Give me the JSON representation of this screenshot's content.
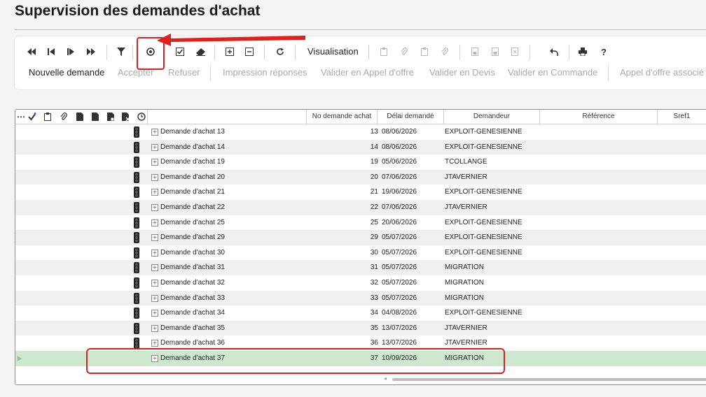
{
  "page": {
    "title": "Supervision des demandes d'achat"
  },
  "toolbar": {
    "visualisation_label": "Visualisation",
    "icons": [
      "first-icon",
      "previous-icon",
      "next-icon",
      "last-icon",
      "filter-icon",
      "target-icon",
      "check-icon",
      "eraser-icon",
      "add-icon",
      "remove-icon",
      "refresh-icon",
      "clipboard-icon",
      "attach-icon",
      "clipboard-icon",
      "attach-icon",
      "doc-icon",
      "doc-icon",
      "doc-icon",
      "undo-icon",
      "print-icon",
      "help-icon"
    ]
  },
  "actions": [
    {
      "label": "Nouvelle demande",
      "enabled": true
    },
    {
      "label": "Accepter",
      "enabled": false
    },
    {
      "label": "Refuser",
      "enabled": false
    },
    {
      "label": "Impression réponses",
      "enabled": false
    },
    {
      "label": "Valider en Appel d'offre",
      "enabled": false
    },
    {
      "label": "Valider en Devis",
      "enabled": false
    },
    {
      "label": "Valider en Commande",
      "enabled": false
    },
    {
      "label": "Appel d'offre associé",
      "enabled": false
    }
  ],
  "grid": {
    "columns": [
      {
        "label": "No demande achat"
      },
      {
        "label": "Délai demandé"
      },
      {
        "label": "Demandeur"
      },
      {
        "label": "Référence"
      },
      {
        "label": "Sref1"
      }
    ],
    "rows": [
      {
        "name": "Demande d'achat 13",
        "no": "13",
        "date": "08/06/2026",
        "demandeur": "EXPLOIT-GENESIENNE"
      },
      {
        "name": "Demande d'achat 14",
        "no": "14",
        "date": "08/06/2026",
        "demandeur": "EXPLOIT-GENESIENNE"
      },
      {
        "name": "Demande d'achat 19",
        "no": "19",
        "date": "05/06/2026",
        "demandeur": "TCOLLANGE"
      },
      {
        "name": "Demande d'achat 20",
        "no": "20",
        "date": "07/06/2026",
        "demandeur": "JTAVERNIER"
      },
      {
        "name": "Demande d'achat 21",
        "no": "21",
        "date": "19/06/2026",
        "demandeur": "EXPLOIT-GENESIENNE"
      },
      {
        "name": "Demande d'achat 22",
        "no": "22",
        "date": "07/06/2026",
        "demandeur": "JTAVERNIER"
      },
      {
        "name": "Demande d'achat 25",
        "no": "25",
        "date": "20/06/2026",
        "demandeur": "EXPLOIT-GENESIENNE"
      },
      {
        "name": "Demande d'achat 29",
        "no": "29",
        "date": "05/07/2026",
        "demandeur": "EXPLOIT-GENESIENNE"
      },
      {
        "name": "Demande d'achat 30",
        "no": "30",
        "date": "05/07/2026",
        "demandeur": "EXPLOIT-GENESIENNE"
      },
      {
        "name": "Demande d'achat 31",
        "no": "31",
        "date": "05/07/2026",
        "demandeur": "MIGRATION"
      },
      {
        "name": "Demande d'achat 32",
        "no": "32",
        "date": "05/07/2026",
        "demandeur": "MIGRATION"
      },
      {
        "name": "Demande d'achat 33",
        "no": "33",
        "date": "05/07/2026",
        "demandeur": "MIGRATION"
      },
      {
        "name": "Demande d'achat 34",
        "no": "34",
        "date": "04/08/2026",
        "demandeur": "EXPLOIT-GENESIENNE"
      },
      {
        "name": "Demande d'achat 35",
        "no": "35",
        "date": "13/07/2026",
        "demandeur": "JTAVERNIER"
      },
      {
        "name": "Demande d'achat 36",
        "no": "36",
        "date": "13/07/2026",
        "demandeur": "JTAVERNIER"
      },
      {
        "name": "Demande d'achat 37",
        "no": "37",
        "date": "10/09/2026",
        "demandeur": "MIGRATION",
        "selected": true
      }
    ]
  },
  "colors": {
    "annotation": "#e0201d",
    "selected_row": "#cde8cf"
  }
}
